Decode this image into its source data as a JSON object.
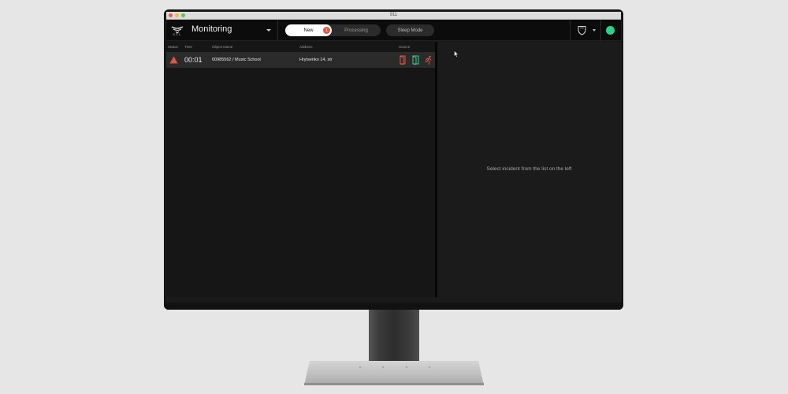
{
  "window": {
    "title": "911"
  },
  "app": {
    "logo_text": "911",
    "title": "Monitoring"
  },
  "tabs": {
    "new_label": "New",
    "new_badge": "1",
    "processing_label": "Processing",
    "sleep_label": "Sleep Mode"
  },
  "status": {
    "color": "#2fd189"
  },
  "table": {
    "headers": {
      "status": "Status",
      "time": "Time",
      "object_name": "Object Name",
      "address": "Address",
      "source": "Source"
    },
    "rows": [
      {
        "status_icon": "alert-triangle-icon",
        "time": "00:01",
        "object_name": "00985562 / Music School",
        "address": "Hrytsenko 14, str",
        "sources": [
          "door-open-red-icon",
          "door-open-green-icon",
          "motion-runner-icon"
        ]
      }
    ]
  },
  "detail": {
    "empty_message": "Select incident from the list on the left"
  },
  "colors": {
    "accent_red": "#e0573f",
    "accent_green": "#2fd189"
  }
}
